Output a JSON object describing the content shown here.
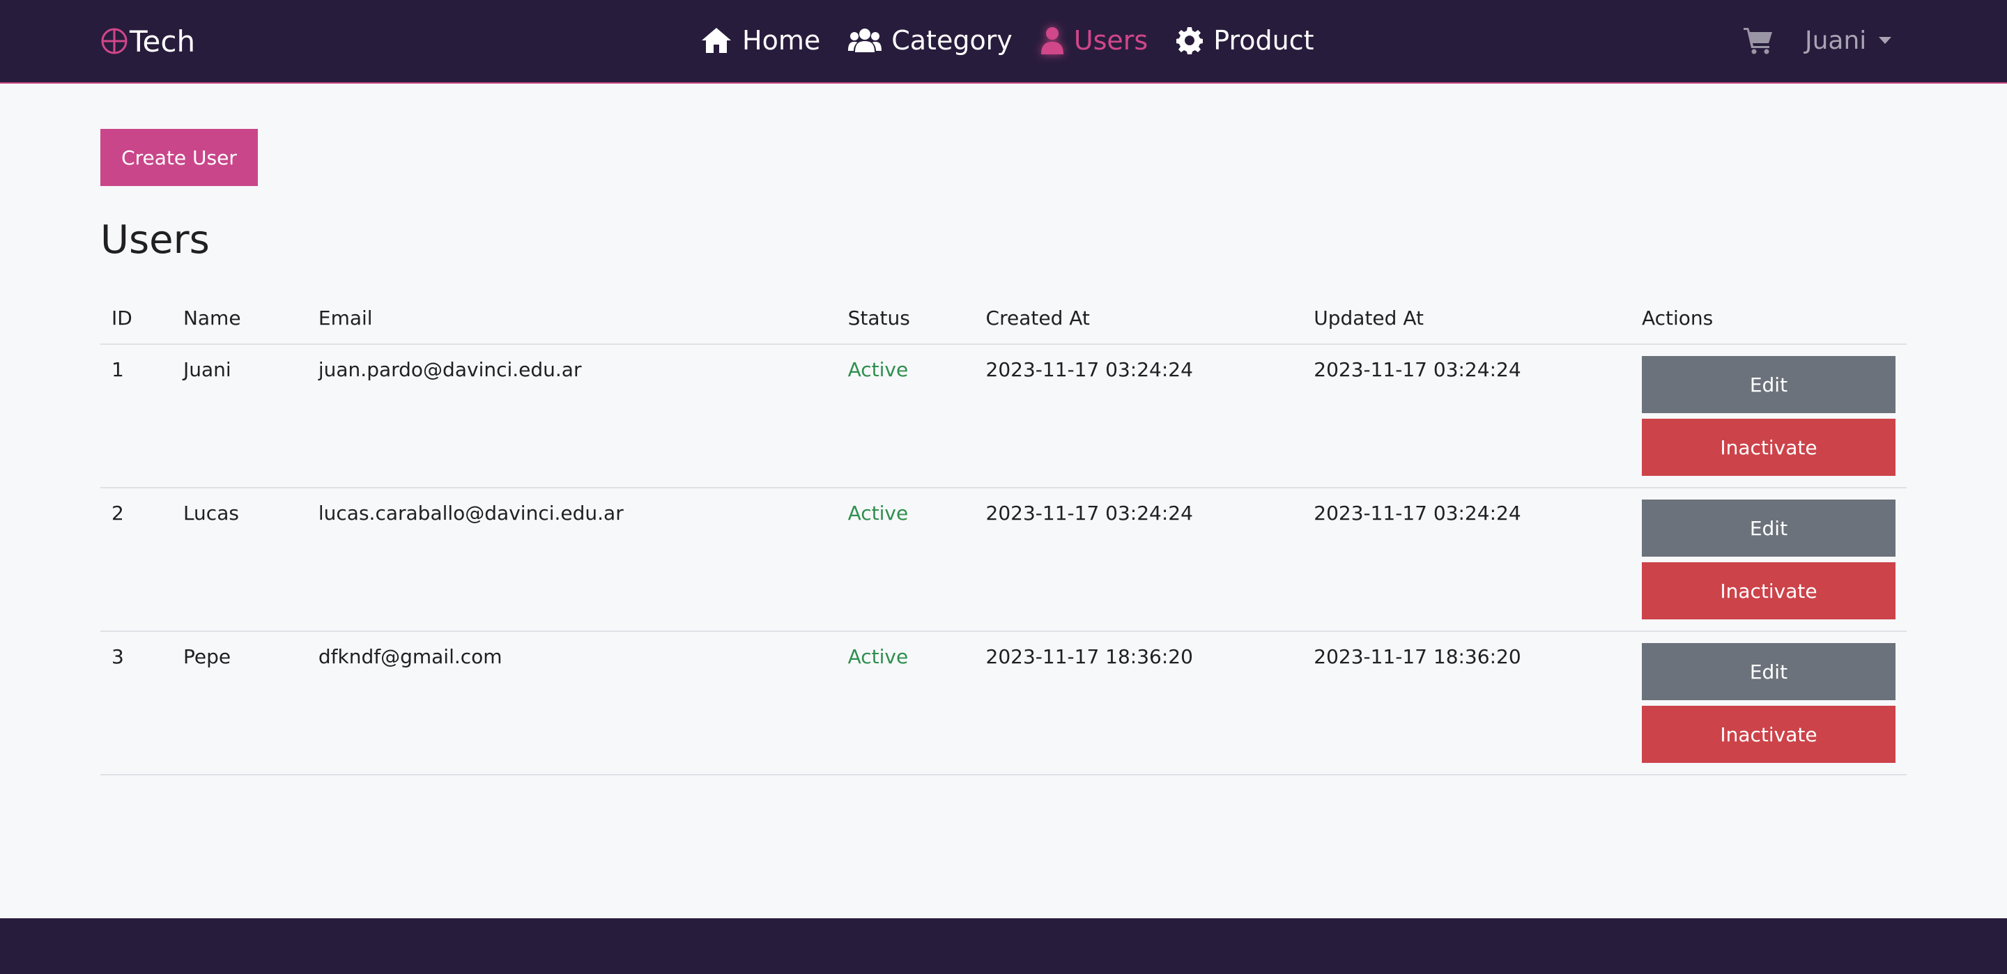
{
  "brand": {
    "name": "Tech"
  },
  "nav": {
    "links": [
      {
        "label": "Home",
        "icon": "home-icon",
        "active": false
      },
      {
        "label": "Category",
        "icon": "users-group-icon",
        "active": false
      },
      {
        "label": "Users",
        "icon": "user-icon",
        "active": true
      },
      {
        "label": "Product",
        "icon": "gear-icon",
        "active": false
      }
    ],
    "user_name": "Juani"
  },
  "colors": {
    "navbar": "#281c3c",
    "accent": "#c9468a",
    "active_status": "#2f8f4e",
    "edit_button": "#6b727c",
    "inactivate_button": "#cc434a"
  },
  "main": {
    "create_button": "Create User",
    "title": "Users",
    "table": {
      "columns": [
        "ID",
        "Name",
        "Email",
        "Status",
        "Created At",
        "Updated At",
        "Actions"
      ],
      "rows": [
        {
          "id": "1",
          "name": "Juani",
          "email": "juan.pardo@davinci.edu.ar",
          "status": "Active",
          "created_at": "2023-11-17 03:24:24",
          "updated_at": "2023-11-17 03:24:24"
        },
        {
          "id": "2",
          "name": "Lucas",
          "email": "lucas.caraballo@davinci.edu.ar",
          "status": "Active",
          "created_at": "2023-11-17 03:24:24",
          "updated_at": "2023-11-17 03:24:24"
        },
        {
          "id": "3",
          "name": "Pepe",
          "email": "dfkndf@gmail.com",
          "status": "Active",
          "created_at": "2023-11-17 18:36:20",
          "updated_at": "2023-11-17 18:36:20"
        }
      ],
      "edit_label": "Edit",
      "inactivate_label": "Inactivate"
    }
  }
}
